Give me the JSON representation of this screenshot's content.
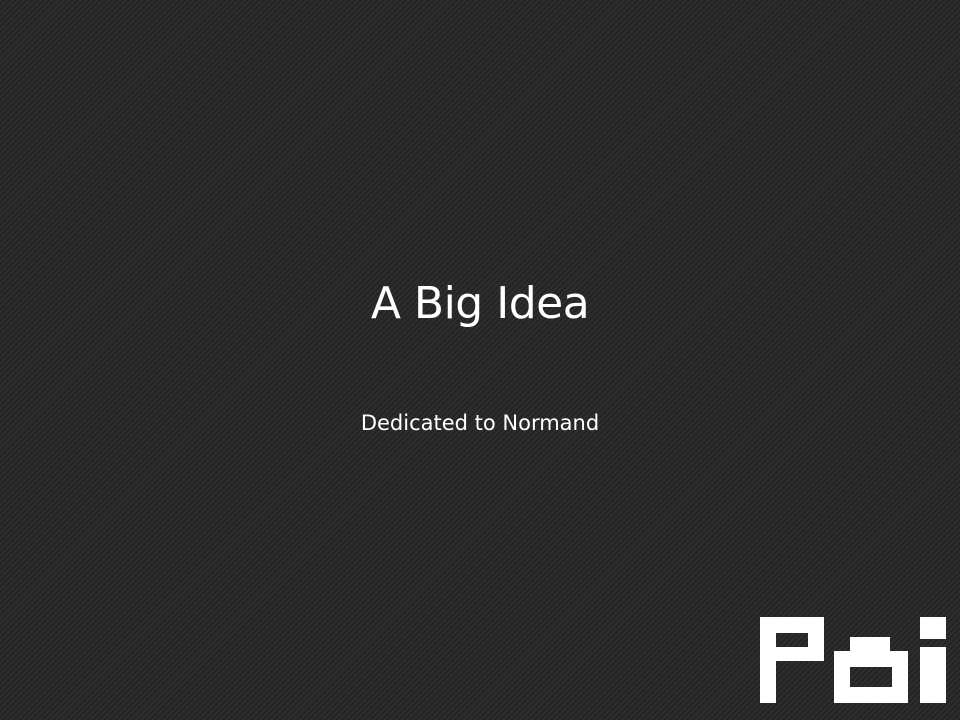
{
  "slide": {
    "title": "A Big Idea",
    "subtitle": "Dedicated to Normand",
    "logo": {
      "icon": "poi-logo",
      "text": "POI",
      "color": "#ffffff"
    },
    "background": {
      "base": "#2b2b2b",
      "pattern": "diagonal-stripes"
    }
  }
}
